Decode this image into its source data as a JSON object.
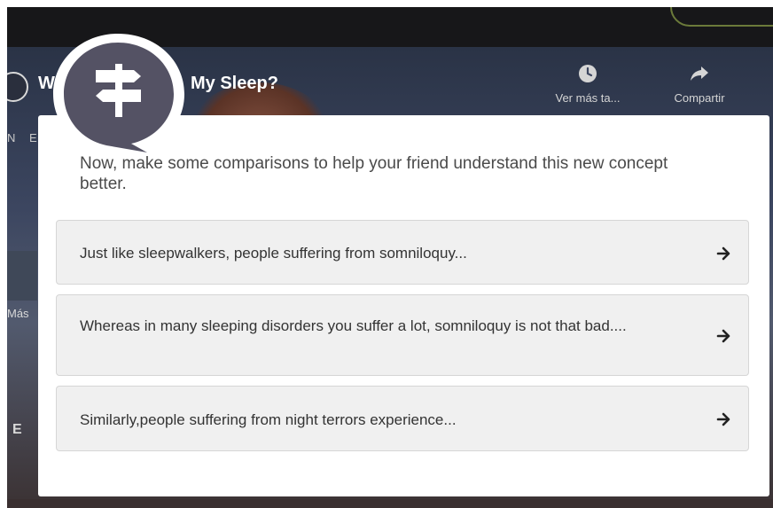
{
  "video": {
    "title_prefix": "W",
    "title": "My Sleep?",
    "channel_letters": "N E",
    "actions": {
      "watch_later": "Ver más ta...",
      "share": "Compartir"
    },
    "side_label": "Más",
    "side_letter": "E"
  },
  "icons": {
    "bubble": "signpost-icon",
    "watch_later": "clock-icon",
    "share": "share-arrow-icon",
    "option_arrow": "arrow-right-icon"
  },
  "colors": {
    "bubble_fill": "#545264",
    "card_bg": "#ffffff",
    "option_bg": "#f0f0f0",
    "option_border": "#d6d6d6",
    "text": "#333333"
  },
  "activity": {
    "prompt": "Now, make some comparisons to help your friend understand this new concept better.",
    "options": [
      {
        "label": "Just like sleepwalkers, people suffering from somniloquy..."
      },
      {
        "label": "Whereas in many sleeping disorders you suffer a lot, somniloquy is not that bad...."
      },
      {
        "label": "Similarly,people suffering from night terrors experience..."
      }
    ]
  }
}
